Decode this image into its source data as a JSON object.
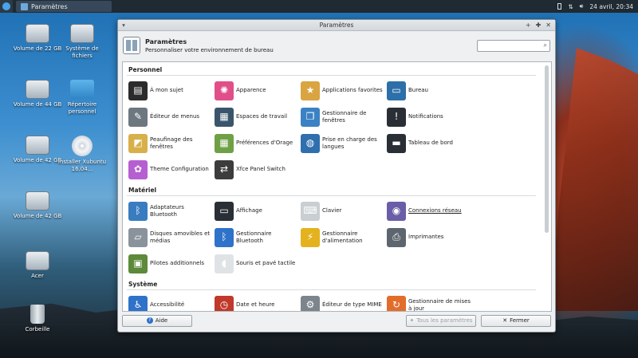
{
  "panel": {
    "task_label": "Paramètres",
    "clock": "24 avril, 20:34"
  },
  "desktop": {
    "icons": [
      {
        "label": "Volume de 22 GB",
        "kind": "drive"
      },
      {
        "label": "Système de fichiers",
        "kind": "drive"
      },
      {
        "label": "Volume de 44 GB",
        "kind": "drive"
      },
      {
        "label": "Répertoire personnel",
        "kind": "folder"
      },
      {
        "label": "Volume de 42 GB",
        "kind": "drive"
      },
      {
        "label": "Installer Xubuntu 16.04...",
        "kind": "disc"
      },
      {
        "label": "Volume de 42 GB",
        "kind": "drive"
      },
      {
        "label": "Acer",
        "kind": "drive"
      },
      {
        "label": "Corbeille",
        "kind": "trash"
      }
    ]
  },
  "window": {
    "title": "Paramètres",
    "header_title": "Paramètres",
    "header_subtitle": "Personnaliser votre environnement de bureau",
    "search_placeholder": "",
    "sections": [
      {
        "title": "Personnel",
        "items": [
          {
            "label": "À mon sujet",
            "icon": "id-card-icon",
            "color": "#2b2b2b"
          },
          {
            "label": "Apparence",
            "icon": "palette-icon",
            "color": "#e14f8a"
          },
          {
            "label": "Applications favorites",
            "icon": "star-box-icon",
            "color": "#d9a441"
          },
          {
            "label": "Bureau",
            "icon": "monitor-icon",
            "color": "#2d6fa8"
          },
          {
            "label": "Éditeur de menus",
            "icon": "menu-edit-icon",
            "color": "#6d7780"
          },
          {
            "label": "Espaces de travail",
            "icon": "workspaces-icon",
            "color": "#3a556b"
          },
          {
            "label": "Gestionnaire de fenêtres",
            "icon": "windows-icon",
            "color": "#3b82c4"
          },
          {
            "label": "Notifications",
            "icon": "notification-icon",
            "color": "#2a2f35"
          },
          {
            "label": "Peaufinage des fenêtres",
            "icon": "window-tweaks-icon",
            "color": "#d8b04a"
          },
          {
            "label": "Préférences d'Orage",
            "icon": "calendar-icon",
            "color": "#6fa046"
          },
          {
            "label": "Prise en charge des langues",
            "icon": "globe-icon",
            "color": "#2f6fae"
          },
          {
            "label": "Tableau de bord",
            "icon": "panel-icon",
            "color": "#2a2f35"
          },
          {
            "label": "Theme Configuration",
            "icon": "color-wheel-icon",
            "color": "#b55fd1"
          },
          {
            "label": "Xfce Panel Switch",
            "icon": "panel-switch-icon",
            "color": "#3c3c3c"
          }
        ]
      },
      {
        "title": "Matériel",
        "items": [
          {
            "label": "Adaptateurs Bluetooth",
            "icon": "bluetooth-device-icon",
            "color": "#3a7cc0"
          },
          {
            "label": "Affichage",
            "icon": "display-icon",
            "color": "#2a2f35"
          },
          {
            "label": "Clavier",
            "icon": "keyboard-icon",
            "color": "#c9ced2"
          },
          {
            "label": "Connexions réseau",
            "icon": "network-icon",
            "color": "#6b5ea8",
            "link": true
          },
          {
            "label": "Disques amovibles et médias",
            "icon": "removable-drive-icon",
            "color": "#8a939b"
          },
          {
            "label": "Gestionnaire Bluetooth",
            "icon": "bluetooth-icon",
            "color": "#2f72c9"
          },
          {
            "label": "Gestionnaire d'alimentation",
            "icon": "power-icon",
            "color": "#e4b21e"
          },
          {
            "label": "Imprimantes",
            "icon": "printer-icon",
            "color": "#5d666e"
          },
          {
            "label": "Pilotes additionnels",
            "icon": "driver-icon",
            "color": "#5c8a3a"
          },
          {
            "label": "Souris et pavé tactile",
            "icon": "mouse-icon",
            "color": "#dfe3e6"
          }
        ]
      },
      {
        "title": "Système",
        "items": [
          {
            "label": "Accessibilité",
            "icon": "accessibility-icon",
            "color": "#2f72c9"
          },
          {
            "label": "Date et heure",
            "icon": "date-time-icon",
            "color": "#c0392b"
          },
          {
            "label": "Éditeur de type MIME",
            "icon": "mime-icon",
            "color": "#7d858c"
          },
          {
            "label": "Gestionnaire de mises à jour",
            "icon": "update-icon",
            "color": "#e26d2b"
          }
        ]
      }
    ],
    "buttons": {
      "help": "Aide",
      "all_settings": "Tous les paramètres",
      "close": "Fermer"
    }
  }
}
